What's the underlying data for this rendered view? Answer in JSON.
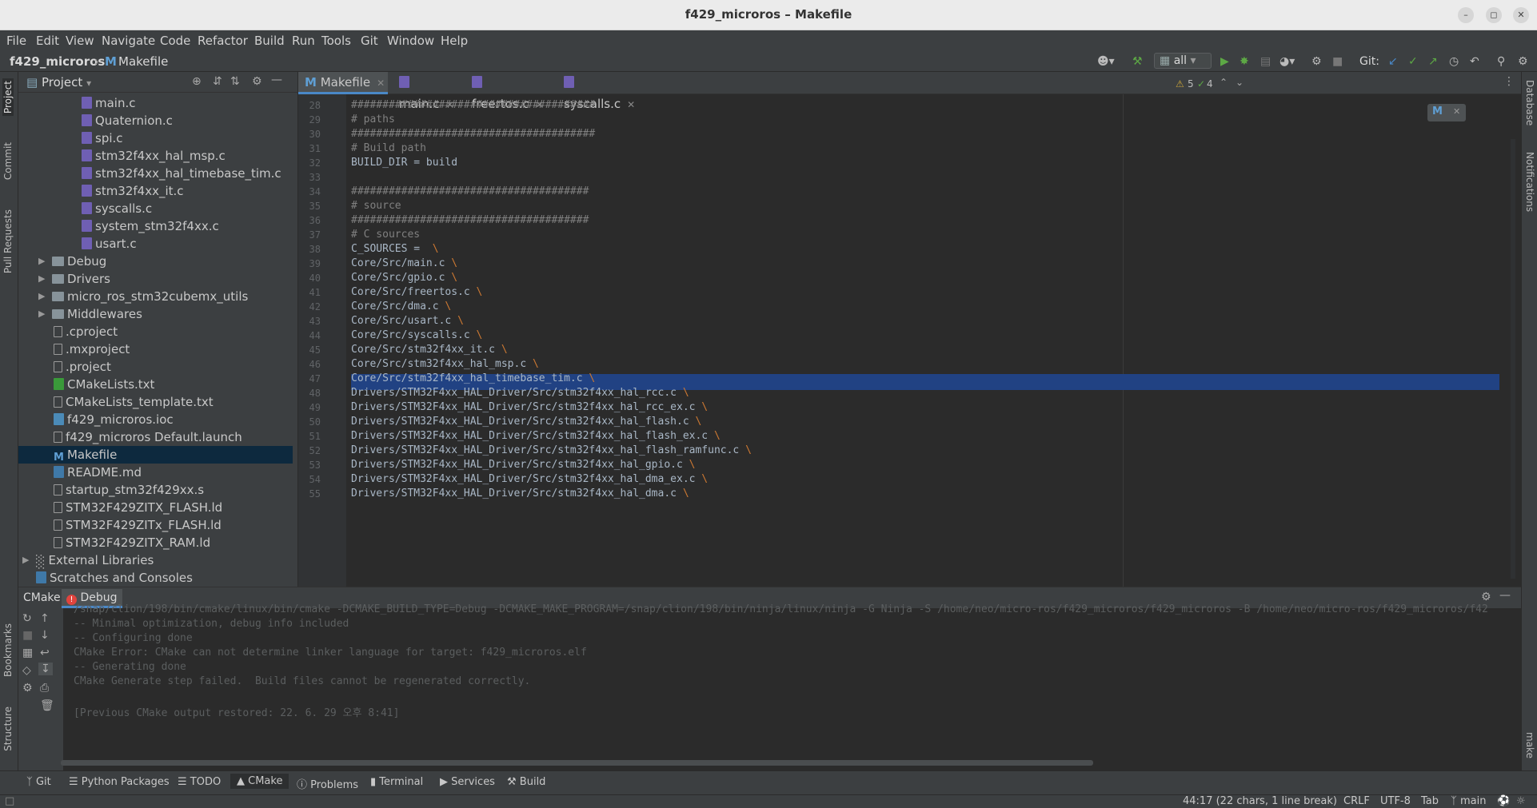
{
  "window": {
    "title": "f429_microros – Makefile"
  },
  "menu": [
    "File",
    "Edit",
    "View",
    "Navigate",
    "Code",
    "Refactor",
    "Build",
    "Run",
    "Tools",
    "Git",
    "Window",
    "Help"
  ],
  "breadcrumb": {
    "project": "f429_microros",
    "file_icon": "M",
    "file": "Makefile"
  },
  "toolbar": {
    "run_config": "all",
    "git_label": "Git:"
  },
  "left_strip": [
    "Project",
    "Commit",
    "Pull Requests",
    "Bookmarks",
    "Structure"
  ],
  "right_strip": [
    "Database",
    "Notifications",
    "make"
  ],
  "project_panel": {
    "title": "Project",
    "items": [
      {
        "label": "main.c",
        "icon": "c-file-icon"
      },
      {
        "label": "Quaternion.c",
        "icon": "c-file-icon"
      },
      {
        "label": "spi.c",
        "icon": "c-file-icon"
      },
      {
        "label": "stm32f4xx_hal_msp.c",
        "icon": "c-file-icon"
      },
      {
        "label": "stm32f4xx_hal_timebase_tim.c",
        "icon": "c-file-icon"
      },
      {
        "label": "stm32f4xx_it.c",
        "icon": "c-file-icon"
      },
      {
        "label": "syscalls.c",
        "icon": "c-file-icon"
      },
      {
        "label": "system_stm32f4xx.c",
        "icon": "c-file-icon"
      },
      {
        "label": "usart.c",
        "icon": "c-file-icon"
      },
      {
        "label": "Debug",
        "icon": "folder-icon"
      },
      {
        "label": "Drivers",
        "icon": "folder-icon"
      },
      {
        "label": "micro_ros_stm32cubemx_utils",
        "icon": "folder-icon"
      },
      {
        "label": "Middlewares",
        "icon": "folder-icon"
      },
      {
        "label": ".cproject",
        "icon": "file-icon"
      },
      {
        "label": ".mxproject",
        "icon": "file-icon"
      },
      {
        "label": ".project",
        "icon": "file-icon"
      },
      {
        "label": "CMakeLists.txt",
        "icon": "cmake-icon"
      },
      {
        "label": "CMakeLists_template.txt",
        "icon": "file-icon"
      },
      {
        "label": "f429_microros.ioc",
        "icon": "ioc-icon"
      },
      {
        "label": "f429_microros Default.launch",
        "icon": "file-icon"
      },
      {
        "label": "Makefile",
        "icon": "makefile-icon"
      },
      {
        "label": "README.md",
        "icon": "markdown-icon"
      },
      {
        "label": "startup_stm32f429xx.s",
        "icon": "file-icon"
      },
      {
        "label": "STM32F429ZITX_FLASH.ld",
        "icon": "file-icon"
      },
      {
        "label": "STM32F429ZITx_FLASH.ld",
        "icon": "file-icon"
      },
      {
        "label": "STM32F429ZITX_RAM.ld",
        "icon": "file-icon"
      },
      {
        "label": "External Libraries",
        "icon": "library-icon"
      },
      {
        "label": "Scratches and Consoles",
        "icon": "scratch-icon"
      }
    ]
  },
  "tabs": [
    {
      "label": "Makefile",
      "icon": "M"
    },
    {
      "label": "main.c",
      "icon": "c"
    },
    {
      "label": "freertos.c",
      "icon": "c"
    },
    {
      "label": "syscalls.c",
      "icon": "c"
    }
  ],
  "inspections": {
    "warnings": "5",
    "ok": "4"
  },
  "editor": {
    "lines": [
      {
        "n": "28",
        "text": "#######################################",
        "kind": "comment"
      },
      {
        "n": "29",
        "text": "# paths",
        "kind": "comment"
      },
      {
        "n": "30",
        "text": "#######################################",
        "kind": "comment"
      },
      {
        "n": "31",
        "text": "# Build path",
        "kind": "comment"
      },
      {
        "n": "32",
        "text": "BUILD_DIR = build",
        "kind": "code"
      },
      {
        "n": "33",
        "text": "",
        "kind": "code"
      },
      {
        "n": "34",
        "text": "######################################",
        "kind": "comment"
      },
      {
        "n": "35",
        "text": "# source",
        "kind": "comment"
      },
      {
        "n": "36",
        "text": "######################################",
        "kind": "comment"
      },
      {
        "n": "37",
        "text": "# C sources",
        "kind": "comment"
      },
      {
        "n": "38",
        "text": "C_SOURCES =  \\",
        "kind": "code"
      },
      {
        "n": "39",
        "text": "Core/Src/main.c \\",
        "kind": "code"
      },
      {
        "n": "40",
        "text": "Core/Src/gpio.c \\",
        "kind": "code"
      },
      {
        "n": "41",
        "text": "Core/Src/freertos.c \\",
        "kind": "code"
      },
      {
        "n": "42",
        "text": "Core/Src/dma.c \\",
        "kind": "code"
      },
      {
        "n": "43",
        "text": "Core/Src/usart.c \\",
        "kind": "code"
      },
      {
        "n": "44",
        "text": "Core/Src/syscalls.c \\",
        "kind": "code"
      },
      {
        "n": "45",
        "text": "Core/Src/stm32f4xx_it.c \\",
        "kind": "code"
      },
      {
        "n": "46",
        "text": "Core/Src/stm32f4xx_hal_msp.c \\",
        "kind": "code"
      },
      {
        "n": "47",
        "text": "Core/Src/stm32f4xx_hal_timebase_tim.c \\",
        "kind": "code"
      },
      {
        "n": "48",
        "text": "Drivers/STM32F4xx_HAL_Driver/Src/stm32f4xx_hal_rcc.c \\",
        "kind": "code"
      },
      {
        "n": "49",
        "text": "Drivers/STM32F4xx_HAL_Driver/Src/stm32f4xx_hal_rcc_ex.c \\",
        "kind": "code"
      },
      {
        "n": "50",
        "text": "Drivers/STM32F4xx_HAL_Driver/Src/stm32f4xx_hal_flash.c \\",
        "kind": "code"
      },
      {
        "n": "51",
        "text": "Drivers/STM32F4xx_HAL_Driver/Src/stm32f4xx_hal_flash_ex.c \\",
        "kind": "code"
      },
      {
        "n": "52",
        "text": "Drivers/STM32F4xx_HAL_Driver/Src/stm32f4xx_hal_flash_ramfunc.c \\",
        "kind": "code"
      },
      {
        "n": "53",
        "text": "Drivers/STM32F4xx_HAL_Driver/Src/stm32f4xx_hal_gpio.c \\",
        "kind": "code"
      },
      {
        "n": "54",
        "text": "Drivers/STM32F4xx_HAL_Driver/Src/stm32f4xx_hal_dma_ex.c \\",
        "kind": "code"
      },
      {
        "n": "55",
        "text": "Drivers/STM32F4xx_HAL_Driver/Src/stm32f4xx_hal_dma.c \\",
        "kind": "code"
      }
    ],
    "current_line": "44"
  },
  "bottom_panel": {
    "tab_cmake": "CMake",
    "tab_debug": "Debug",
    "output": [
      "/snap/clion/198/bin/cmake/linux/bin/cmake -DCMAKE_BUILD_TYPE=Debug -DCMAKE_MAKE_PROGRAM=/snap/clion/198/bin/ninja/linux/ninja -G Ninja -S /home/neo/micro-ros/f429_microros/f429_microros -B /home/neo/micro-ros/f429_microros/f42",
      "-- Minimal optimization, debug info included",
      "-- Configuring done",
      "CMake Error: CMake can not determine linker language for target: f429_microros.elf",
      "-- Generating done",
      "CMake Generate step failed.  Build files cannot be regenerated correctly.",
      "",
      "[Previous CMake output restored: 22. 6. 29 오후 8:41]"
    ]
  },
  "tool_windows": [
    "Git",
    "Python Packages",
    "TODO",
    "CMake",
    "Problems",
    "Terminal",
    "Services",
    "Build"
  ],
  "status": {
    "position": "44:17 (22 chars, 1 line break)",
    "line_sep": "CRLF",
    "encoding": "UTF-8",
    "indent": "Tab",
    "branch": "main"
  },
  "colors": {
    "accent": "#4a88c7",
    "selection": "#214283",
    "error": "#e0443e"
  }
}
